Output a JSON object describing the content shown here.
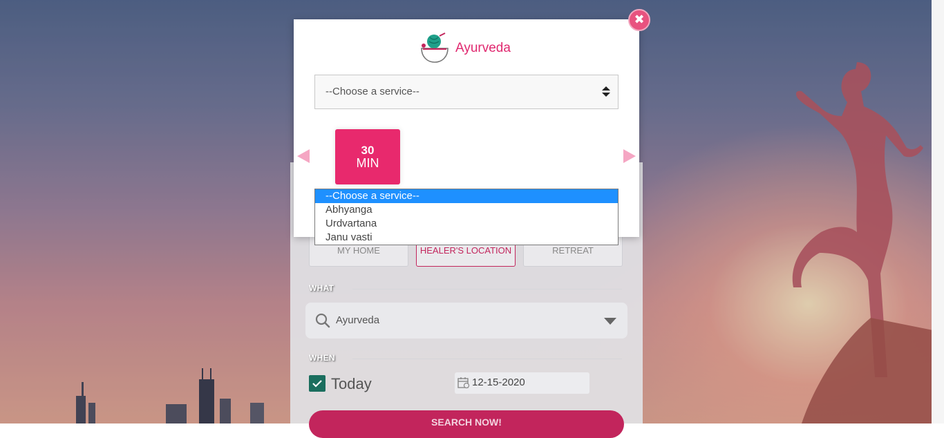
{
  "modal": {
    "category_title": "Ayurveda",
    "service_select": {
      "value": "--Choose a service--",
      "options": [
        "--Choose a service--",
        "Abhyanga",
        "Urdvartana",
        "Janu vasti"
      ],
      "selected_index": 0
    },
    "duration": {
      "value": "30",
      "unit": "MIN"
    }
  },
  "form": {
    "location_options": [
      "MY HOME",
      "HEALER'S LOCATION",
      "RETREAT"
    ],
    "active_location": "HEALER'S LOCATION",
    "what_label": "WHAT",
    "what_value": "Ayurveda",
    "when_label": "WHEN",
    "today_label": "Today",
    "today_checked": true,
    "date_value": "12-15-2020",
    "search_button": "SEARCH NOW!"
  },
  "colors": {
    "accent": "#e8296d",
    "highlight": "#1e90ff",
    "checkbox": "#1b6e5e"
  },
  "icons": [
    "close-icon",
    "ayurveda-logo-icon",
    "select-arrows-icon",
    "carousel-prev-icon",
    "carousel-next-icon",
    "search-icon",
    "chevron-down-icon",
    "checkmark-icon",
    "calendar-icon"
  ]
}
